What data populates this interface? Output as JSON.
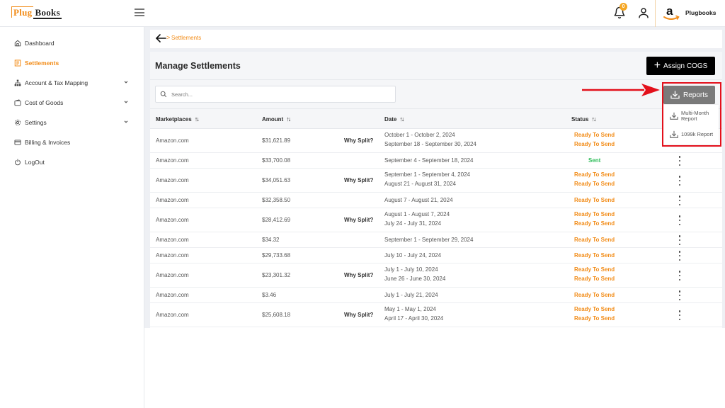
{
  "header": {
    "logo": {
      "part1": "Plug",
      "part2": "Books"
    },
    "menu_icon": "hamburger-icon",
    "notification_count": "0",
    "account_name": "Plugbooks"
  },
  "sidebar": {
    "items": [
      {
        "label": "Dashboard",
        "icon": "home-icon",
        "active": false,
        "expandable": false
      },
      {
        "label": "Settlements",
        "icon": "document-icon",
        "active": true,
        "expandable": false
      },
      {
        "label": "Account & Tax Mapping",
        "icon": "sitemap-icon",
        "active": false,
        "expandable": true
      },
      {
        "label": "Cost of Goods",
        "icon": "wallet-icon",
        "active": false,
        "expandable": true
      },
      {
        "label": "Settings",
        "icon": "gear-icon",
        "active": false,
        "expandable": true
      },
      {
        "label": "Billing & Invoices",
        "icon": "credit-card-icon",
        "active": false,
        "expandable": false
      },
      {
        "label": "LogOut",
        "icon": "power-icon",
        "active": false,
        "expandable": false
      }
    ]
  },
  "breadcrumb": {
    "current": "Settlements"
  },
  "main": {
    "title": "Manage Settlements",
    "assign_cogs_label": "Assign COGS",
    "search_placeholder": "Search...",
    "reports_label": "Reports",
    "reports_menu": [
      {
        "label_line1": "Multi-Month",
        "label_line2": "Report"
      },
      {
        "label_line1": "1099k Report",
        "label_line2": ""
      }
    ]
  },
  "table": {
    "columns": [
      "Marketplaces",
      "Amount",
      "Date",
      "Status"
    ],
    "split_label": "Why Split?",
    "rows": [
      {
        "marketplace": "Amazon.com",
        "amount": "$31,621.89",
        "split": true,
        "dates": [
          "October 1 - October 2, 2024",
          "September 18 - September 30, 2024"
        ],
        "statuses": [
          "Ready To Send",
          "Ready To Send"
        ]
      },
      {
        "marketplace": "Amazon.com",
        "amount": "$33,700.08",
        "split": false,
        "dates": [
          "September 4 - September 18, 2024"
        ],
        "statuses": [
          "Sent"
        ]
      },
      {
        "marketplace": "Amazon.com",
        "amount": "$34,051.63",
        "split": true,
        "dates": [
          "September 1 - September 4, 2024",
          "August 21 - August 31, 2024"
        ],
        "statuses": [
          "Ready To Send",
          "Ready To Send"
        ]
      },
      {
        "marketplace": "Amazon.com",
        "amount": "$32,358.50",
        "split": false,
        "dates": [
          "August 7 - August 21, 2024"
        ],
        "statuses": [
          "Ready To Send"
        ]
      },
      {
        "marketplace": "Amazon.com",
        "amount": "$28,412.69",
        "split": true,
        "dates": [
          "August 1 - August 7, 2024",
          "July 24 - July 31, 2024"
        ],
        "statuses": [
          "Ready To Send",
          "Ready To Send"
        ]
      },
      {
        "marketplace": "Amazon.com",
        "amount": "$34.32",
        "split": false,
        "dates": [
          "September 1 - September 29, 2024"
        ],
        "statuses": [
          "Ready To Send"
        ]
      },
      {
        "marketplace": "Amazon.com",
        "amount": "$29,733.68",
        "split": false,
        "dates": [
          "July 10 - July 24, 2024"
        ],
        "statuses": [
          "Ready To Send"
        ]
      },
      {
        "marketplace": "Amazon.com",
        "amount": "$23,301.32",
        "split": true,
        "dates": [
          "July 1 - July 10, 2024",
          "June 26 - June 30, 2024"
        ],
        "statuses": [
          "Ready To Send",
          "Ready To Send"
        ]
      },
      {
        "marketplace": "Amazon.com",
        "amount": "$3.46",
        "split": false,
        "dates": [
          "July 1 - July 21, 2024"
        ],
        "statuses": [
          "Ready To Send"
        ]
      },
      {
        "marketplace": "Amazon.com",
        "amount": "$25,608.18",
        "split": true,
        "dates": [
          "May 1 - May 1, 2024",
          "April 17 - April 30, 2024"
        ],
        "statuses": [
          "Ready To Send",
          "Ready To Send"
        ]
      }
    ]
  },
  "colors": {
    "accent": "#f28c18",
    "sent": "#2ebd59",
    "annotation": "#e3101b",
    "primary_button": "#000000",
    "reports_button": "#7a7a7a"
  }
}
